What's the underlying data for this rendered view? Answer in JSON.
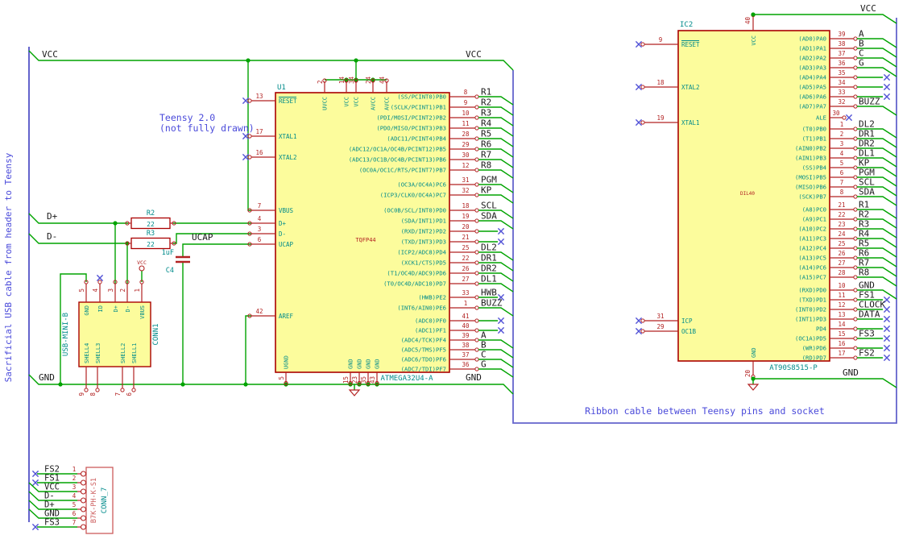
{
  "colors": {
    "background": "#FFFFFF",
    "wire_green": "#00A300",
    "pin_red": "#B22222",
    "body_outline": "#AA0000",
    "body_fill": "#FCFC9C",
    "pin_name_teal": "#008B8B",
    "net_label_black": "#1A1A1A",
    "note_blue": "#4A4ADA",
    "cable_blue": "#6464CC",
    "no_connect_blue": "#5252D6",
    "value_pink": "#CC5C5C"
  },
  "notes": {
    "left_cable": "Sacrificial USB cable from header to Teensy",
    "teensy_line1": "Teensy 2.0",
    "teensy_line2": "(not fully drawn)",
    "ribbon": "Ribbon cable between Teensy pins and socket"
  },
  "net_labels": {
    "vcc": "VCC",
    "gnd": "GND",
    "dplus": "D+",
    "dminus": "D-",
    "ucap": "UCAP"
  },
  "components": {
    "u1": {
      "ref": "U1",
      "value": "ATMEGA32U4-A",
      "footprint": "TQFP44",
      "left_pins": [
        {
          "num": "13",
          "name": "RESET",
          "nc": true,
          "bar": true
        },
        {
          "num": "17",
          "name": "XTAL1",
          "nc": true
        },
        {
          "num": "16",
          "name": "XTAL2",
          "nc": true
        },
        {
          "num": "7",
          "name": "VBUS"
        },
        {
          "num": "4",
          "name": "D+"
        },
        {
          "num": "3",
          "name": "D-"
        },
        {
          "num": "6",
          "name": "UCAP"
        },
        {
          "num": "42",
          "name": "AREF"
        }
      ],
      "top_pins": [
        {
          "num": "2",
          "name": "UVCC"
        },
        {
          "num": "14",
          "name": "VCC"
        },
        {
          "num": "34",
          "name": "VCC"
        },
        {
          "num": "24",
          "name": "AVCC"
        },
        {
          "num": "44",
          "name": "AVCC"
        }
      ],
      "bottom_pins": [
        {
          "num": "5",
          "name": "UGND"
        },
        {
          "num": "15",
          "name": "GND"
        },
        {
          "num": "23",
          "name": "GND"
        },
        {
          "num": "35",
          "name": "GND"
        },
        {
          "num": "43",
          "name": "GND"
        }
      ],
      "right_pins": [
        {
          "num": "8",
          "name": "(SS/PCINT0)PB0",
          "label": "R1"
        },
        {
          "num": "9",
          "name": "(SCLK/PCINT1)PB1",
          "label": "R2"
        },
        {
          "num": "10",
          "name": "(PDI/MOSI/PCINT2)PB2",
          "label": "R3"
        },
        {
          "num": "11",
          "name": "(PDO/MISO/PCINT3)PB3",
          "label": "R4"
        },
        {
          "num": "28",
          "name": "(ADC11/PCINT4)PB4",
          "label": "R5"
        },
        {
          "num": "29",
          "name": "(ADC12/OC1A/OC4B/PCINT12)PB5",
          "label": "R6"
        },
        {
          "num": "30",
          "name": "(ADC13/OC1B/OC4B/PCINT13)PB6",
          "label": "R7"
        },
        {
          "num": "12",
          "name": "(OC0A/OC1C/RTS/PCINT7)PB7",
          "label": "R8"
        },
        {
          "num": "31",
          "name": "(OC3A/OC4A)PC6",
          "label": "PGM"
        },
        {
          "num": "32",
          "name": "(ICP3/CLK0/OC4A)PC7",
          "label": "KP"
        },
        {
          "num": "18",
          "name": "(OC0B/SCL/INT0)PD0",
          "label": "SCL"
        },
        {
          "num": "19",
          "name": "(SDA/INT1)PD1",
          "label": "SDA"
        },
        {
          "num": "20",
          "name": "(RXD/INT2)PD2",
          "nc": true
        },
        {
          "num": "21",
          "name": "(TXD/INT3)PD3",
          "nc": true
        },
        {
          "num": "25",
          "name": "(ICP2/ADC8)PD4",
          "label": "DL2"
        },
        {
          "num": "22",
          "name": "(XCK1/CTS)PD5",
          "label": "DR1"
        },
        {
          "num": "26",
          "name": "(T1/OC4D/ADC9)PD6",
          "label": "DR2"
        },
        {
          "num": "27",
          "name": "(T0/OC4D/ADC10)PD7",
          "label": "DL1"
        },
        {
          "num": "33",
          "name": "(HWB)PE2",
          "label": "HWB",
          "nc": true
        },
        {
          "num": "1",
          "name": "(INT6/AIN0)PE6",
          "label": "BUZZ"
        },
        {
          "num": "41",
          "name": "(ADC0)PF0",
          "nc": true
        },
        {
          "num": "40",
          "name": "(ADC1)PF1",
          "nc": true
        },
        {
          "num": "39",
          "name": "(ADC4/TCK)PF4",
          "label": "A"
        },
        {
          "num": "38",
          "name": "(ADC5/TMS)PF5",
          "label": "B"
        },
        {
          "num": "37",
          "name": "(ADC6/TDO)PF6",
          "label": "C"
        },
        {
          "num": "36",
          "name": "(ADC7/TDI)PF7",
          "label": "G"
        }
      ]
    },
    "ic2": {
      "ref": "IC2",
      "value": "AT90S8515-P",
      "footprint": "DIL40",
      "left_pins": [
        {
          "num": "9",
          "name": "RESET",
          "nc": true,
          "bar": true
        },
        {
          "num": "18",
          "name": "XTAL2",
          "nc": true
        },
        {
          "num": "19",
          "name": "XTAL1",
          "nc": true
        },
        {
          "num": "31",
          "name": "ICP",
          "nc": true
        },
        {
          "num": "29",
          "name": "OC1B",
          "nc": true
        }
      ],
      "top_pin": {
        "num": "40",
        "name": "VCC"
      },
      "bottom_pin": {
        "num": "20",
        "name": "GND"
      },
      "right_pins": [
        {
          "num": "39",
          "name": "(AD0)PA0",
          "label": "A"
        },
        {
          "num": "38",
          "name": "(AD1)PA1",
          "label": "B"
        },
        {
          "num": "37",
          "name": "(AD2)PA2",
          "label": "C"
        },
        {
          "num": "36",
          "name": "(AD3)PA3",
          "label": "G"
        },
        {
          "num": "35",
          "name": "(AD4)PA4",
          "nc": true
        },
        {
          "num": "34",
          "name": "(AD5)PA5",
          "nc": true
        },
        {
          "num": "33",
          "name": "(AD6)PA6",
          "nc": true
        },
        {
          "num": "32",
          "name": "(AD7)PA7",
          "label": "BUZZ"
        },
        {
          "num": "30",
          "name": "ALE",
          "nc": true,
          "short": true
        },
        {
          "num": "1",
          "name": "(T0)PB0",
          "label": "DL2"
        },
        {
          "num": "2",
          "name": "(T1)PB1",
          "label": "DR1"
        },
        {
          "num": "3",
          "name": "(AIN0)PB2",
          "label": "DR2"
        },
        {
          "num": "4",
          "name": "(AIN1)PB3",
          "label": "DL1"
        },
        {
          "num": "5",
          "name": "(SS)PB4",
          "label": "KP"
        },
        {
          "num": "6",
          "name": "(MOSI)PB5",
          "label": "PGM"
        },
        {
          "num": "7",
          "name": "(MISO)PB6",
          "label": "SCL"
        },
        {
          "num": "8",
          "name": "(SCK)PB7",
          "label": "SDA"
        },
        {
          "num": "21",
          "name": "(A8)PC0",
          "label": "R1"
        },
        {
          "num": "22",
          "name": "(A9)PC1",
          "label": "R2"
        },
        {
          "num": "23",
          "name": "(A10)PC2",
          "label": "R3"
        },
        {
          "num": "24",
          "name": "(A11)PC3",
          "label": "R4"
        },
        {
          "num": "25",
          "name": "(A12)PC4",
          "label": "R5"
        },
        {
          "num": "26",
          "name": "(A13)PC5",
          "label": "R6"
        },
        {
          "num": "27",
          "name": "(A14)PC6",
          "label": "R7"
        },
        {
          "num": "28",
          "name": "(A15)PC7",
          "label": "R8"
        },
        {
          "num": "10",
          "name": "(RXD)PD0",
          "label": "GND"
        },
        {
          "num": "11",
          "name": "(TXD)PD1",
          "label": "FS1",
          "nc": true
        },
        {
          "num": "12",
          "name": "(INT0)PD2",
          "label": "CLOCK",
          "nc": true
        },
        {
          "num": "13",
          "name": "(INT1)PD3",
          "label": "DATA",
          "nc": true
        },
        {
          "num": "14",
          "name": "PD4",
          "nc": true
        },
        {
          "num": "15",
          "name": "(OC1A)PD5",
          "label": "FS3",
          "nc": true
        },
        {
          "num": "16",
          "name": "(WR)PD6",
          "nc": true
        },
        {
          "num": "17",
          "name": "(RD)PD7",
          "label": "FS2",
          "nc": true
        }
      ]
    },
    "con1": {
      "ref": "CONN1",
      "value": "USB-MINI-B",
      "top_pins": [
        {
          "num": "5",
          "name": "GND"
        },
        {
          "num": "4",
          "name": "ID",
          "nc": true
        },
        {
          "num": "3",
          "name": "D+"
        },
        {
          "num": "2",
          "name": "D-"
        },
        {
          "num": "1",
          "name": "VBUS"
        }
      ],
      "bottom_pins": [
        {
          "num": "9",
          "name": "SHELL4"
        },
        {
          "num": "8",
          "name": "SHELL3"
        },
        {
          "num": "7",
          "name": "SHELL2"
        },
        {
          "num": "6",
          "name": "SHELL1"
        }
      ]
    },
    "conn7": {
      "ref": "CONN_7",
      "value": "B7K-PH-K-S1",
      "pins": [
        {
          "num": "1",
          "label": "FS2",
          "nc": true
        },
        {
          "num": "2",
          "label": "FS1",
          "nc": true
        },
        {
          "num": "3",
          "label": "VCC"
        },
        {
          "num": "4",
          "label": "D-"
        },
        {
          "num": "5",
          "label": "D+"
        },
        {
          "num": "6",
          "label": "GND"
        },
        {
          "num": "7",
          "label": "FS3",
          "nc": true
        }
      ]
    },
    "r2": {
      "ref": "R2",
      "value": "22"
    },
    "r3": {
      "ref": "R3",
      "value": "22"
    },
    "c4": {
      "ref": "C4",
      "value": "1uF"
    }
  }
}
